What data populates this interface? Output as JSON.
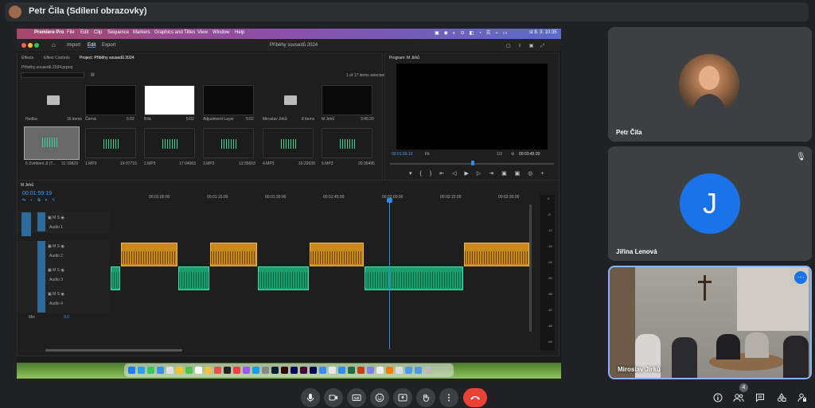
{
  "meet": {
    "presenter_label": "Petr Čila (Sdílení obrazovky)",
    "participants": [
      {
        "name": "Petr Čila"
      },
      {
        "name": "Jiřina Lenová",
        "initial": "J",
        "avatar_color": "#1a73e8"
      },
      {
        "name": "Miroslav Jirků"
      }
    ],
    "people_count": "4",
    "accent_red": "#ea4335",
    "accent_blue": "#8ab4f8"
  },
  "mac_menubar": {
    "items": [
      "Premiere Pro",
      "File",
      "Edit",
      "Clip",
      "Sequence",
      "Markers",
      "Graphics and Titles",
      "View",
      "Window",
      "Help"
    ],
    "clock": "st 8. 3.  10:35"
  },
  "premiere": {
    "header_tabs": [
      "Import",
      "Edit",
      "Export"
    ],
    "project_title": "Příběhy sousedů 2024",
    "panel_tabs": [
      "Effects",
      "Effect Controls",
      "Project: Příběhy sousedů 2024"
    ],
    "project_path": "Příběhy sousedů 2024.prproj",
    "items_selected": "1 of 17 items selected",
    "bins": [
      {
        "name": "Hudba",
        "meta": "16 items"
      },
      {
        "name": "Černá",
        "meta": "5:02"
      },
      {
        "name": "Bílá",
        "meta": "5:02"
      },
      {
        "name": "Adjustment Layer",
        "meta": "5:02"
      },
      {
        "name": "Miroslav Jirků",
        "meta": "8 items"
      },
      {
        "name": "M Jirků",
        "meta": "3:45:20"
      }
    ],
    "audio_items": [
      {
        "name": "5 Zvětšení.Jl (T...",
        "meta": "31:19829"
      },
      {
        "name": "1.MP3",
        "meta": "14:07716"
      },
      {
        "name": "2.MP3",
        "meta": "17:04063"
      },
      {
        "name": "3.MP3",
        "meta": "13:35693"
      },
      {
        "name": "4.MP3",
        "meta": "15:22639"
      },
      {
        "name": "5.MP3",
        "meta": "20:35495"
      }
    ],
    "program_monitor": {
      "title": "Program: M Jirků",
      "timecode": "00:01:59:19",
      "fit": "Fit",
      "resolution": "1/2",
      "duration": "00:03:45:20"
    },
    "timeline": {
      "sequence_tab": "M Jirků",
      "timecode": "00:01:59:19",
      "ruler": [
        "00:01:00:00",
        "00:01:15:00",
        "00:01:30:00",
        "00:01:45:00",
        "00:02:00:00",
        "00:02:15:00",
        "00:02:30:00"
      ],
      "tracks": [
        "Audio 1",
        "Audio 2",
        "Audio 3",
        "Audio 4"
      ],
      "mix": "Mix",
      "mix_value": "0.0",
      "db_scale": [
        "0",
        "-6",
        "-12",
        "-18",
        "-24",
        "-30",
        "-36",
        "-42",
        "-48",
        "-54"
      ]
    }
  }
}
